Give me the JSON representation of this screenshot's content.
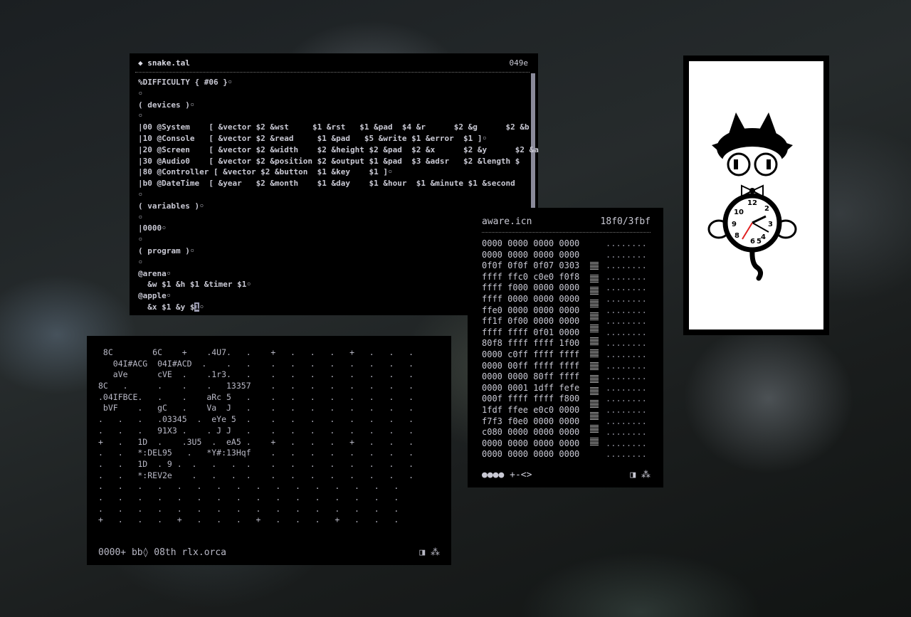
{
  "editor": {
    "title": "◆ snake.tal",
    "address": "049e",
    "lines": [
      "%DIFFICULTY { #06 }◦",
      "◦",
      "( devices )◦",
      "◦",
      "|00 @System    [ &vector $2 &wst     $1 &rst   $1 &pad  $4 &r      $2 &g      $2 &b",
      "|10 @Console   [ &vector $2 &read     $1 &pad   $5 &write $1 &error  $1 ]◦",
      "|20 @Screen    [ &vector $2 &width    $2 &height $2 &pad  $2 &x      $2 &y      $2 &a",
      "|30 @Audio0    [ &vector $2 &position $2 &output $1 &pad  $3 &adsr   $2 &length $",
      "|80 @Controller [ &vector $2 &button  $1 &key    $1 ]◦",
      "|b0 @DateTime  [ &year   $2 &month    $1 &day    $1 &hour  $1 &minute $1 &second",
      "◦",
      "( variables )◦",
      "◦",
      "|0000◦",
      "◦",
      "( program )◦",
      "◦",
      "@arena◦",
      "  &w $1 &h $1 &timer $1◦",
      "@apple◦",
      "  &x $1 &y $"
    ],
    "cursor_char": "1",
    "cursor_tail": "◦"
  },
  "orca": {
    "rows": [
      " 8C        6C    +    .4U7.   .    +   .   .   .   +   .   .   .",
      "   04I#ACG  04I#ACD  .    .   .    .   .   .   .   .   .   .   .",
      "   aVe      cVE  .    .1r3.   .    .   .   .   .   .   .   .   .",
      "8C   .      .    .    .   13357    .   .   .   .   .   .   .   .",
      ".04IFBCE.   .    .    aRc 5   .    .   .   .   .   .   .   .   .",
      " bVF    .   gC   .    Va  J   .    .   .   .   .   .   .   .   .",
      ".   .   .   .03345  .  eYe 5  .    .   .   .   .   .   .   .   .",
      ".   .   .   91X3 .    . J J   .    .   .   .   .   .   .   .   .",
      "+   .   1D  .    .3U5  .  eA5 .    +   .   .   .   +   .   .   .",
      ".   .   *:DEL95   .   *Y#:13Hqf    .   .   .   .   .   .   .   .",
      ".   .   1D  . 9 .  .   .   .  .    .   .   .   .   .   .   .   .",
      ".   .   *:REV2e    .   .   .  .    .   .   .   .   .   .   .   .",
      ".   .   .   .   .   .   .   .   .   .   .   .   .   .   .   .",
      ".   .   .   .   .   .   .   .   .   .   .   .   .   .   .   .",
      ".   .   .   .   .   .   .   .   .   .   .   .   .   .   .   .",
      "+   .   .   .   +   .   .   .   +   .   .   .   +   .   .   ."
    ],
    "status": "0000+ bb◊ 08th rlx.orca",
    "icons": "◨ ⁂"
  },
  "hex": {
    "title": "aware.icn",
    "range": "18f0/3fbf",
    "rows": [
      "0000 0000 0000 0000",
      "0000 0000 0000 0000",
      "0f0f 0f0f 0f07 0303",
      "ffff ffc0 c0e0 f0f8",
      "ffff f000 0000 0000",
      "ffff 0000 0000 0000",
      "ffe0 0000 0000 0000",
      "ff1f 0f00 0000 0000",
      "ffff ffff 0f01 0000",
      "80f8 ffff ffff 1f00",
      "0000 c0ff ffff ffff",
      "0000 00ff ffff ffff",
      "0000 0000 80ff ffff",
      "0000 0001 1dff fefe",
      "000f ffff ffff f800",
      "1fdf ffee e0c0 0000",
      "f7f3 f0e0 0000 0000",
      "c080 0000 0000 0000",
      "0000 0000 0000 0000",
      "0000 0000 0000 0000"
    ],
    "dots": "........",
    "bottom": "●●●● +-<>",
    "icons": "◨ ⁂"
  },
  "clock": {
    "numbers": [
      "12",
      "9",
      "6",
      "4",
      "5",
      "10",
      "8",
      "2",
      "3"
    ]
  },
  "colors": {
    "window_bg": "#000000",
    "text": "#c9c9d4",
    "highlight": "#7b7b8c"
  }
}
